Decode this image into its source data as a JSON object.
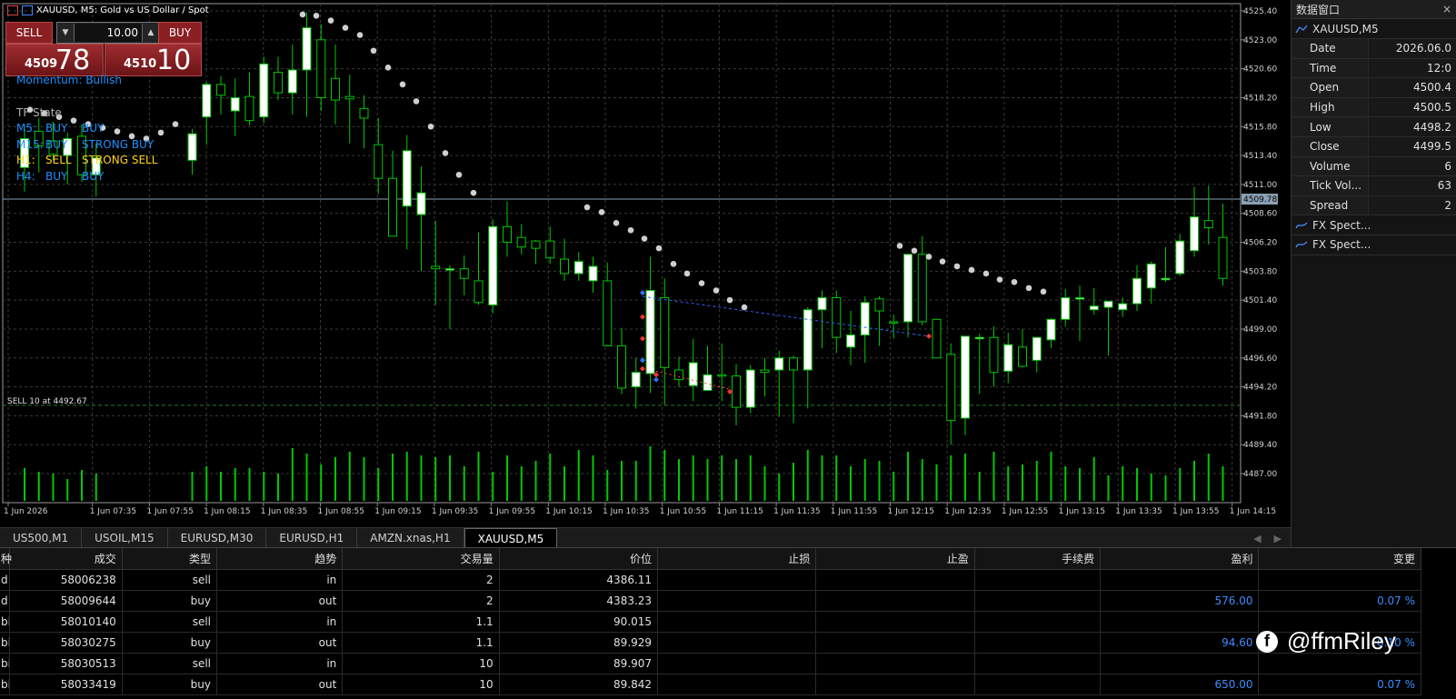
{
  "chart": {
    "header": "XAUUSD, M5:  Gold vs US Dollar / Spot",
    "price_ticks": [
      "4525.40",
      "4523.00",
      "4520.60",
      "4518.20",
      "4515.80",
      "4513.40",
      "4511.00",
      "4508.60",
      "4506.20",
      "4503.80",
      "4501.40",
      "4499.00",
      "4496.60",
      "4494.20",
      "4491.80",
      "4489.40",
      "4487.00"
    ],
    "current_price_label": "4509.78",
    "time_ticks": [
      "1 Jun 2026",
      "1 Jun 07:35",
      "1 Jun 07:55",
      "1 Jun 08:15",
      "1 Jun 08:35",
      "1 Jun 08:55",
      "1 Jun 09:15",
      "1 Jun 09:35",
      "1 Jun 09:55",
      "1 Jun 10:15",
      "1 Jun 10:35",
      "1 Jun 10:55",
      "1 Jun 11:15",
      "1 Jun 11:35",
      "1 Jun 11:55",
      "1 Jun 12:15",
      "1 Jun 12:35",
      "1 Jun 12:55",
      "1 Jun 13:15",
      "1 Jun 13:35",
      "1 Jun 13:55",
      "1 Jun 14:15"
    ],
    "sell_label": "SELL 10 at 4492.67",
    "momentum": "Momentum: Bullish",
    "tf_state_title": "TF State",
    "tf_rows": [
      {
        "tf": "M5:",
        "a": "BUY",
        "b": "BUY",
        "color": "#1e90ff"
      },
      {
        "tf": "M15:",
        "a": "BUY",
        "b": "STRONG BUY",
        "color": "#1e90ff"
      },
      {
        "tf": "H1:",
        "a": "SELL",
        "b": "STRONG SELL",
        "color": "#ffd21f"
      },
      {
        "tf": "H4:",
        "a": "BUY",
        "b": "BUY",
        "color": "#1e90ff"
      }
    ],
    "colors": {
      "bull_body": "#ffffff",
      "bear_body": "#000000",
      "wick": "#00c800",
      "grid": "#3a3a3a",
      "psar": "#cfcfcf"
    }
  },
  "one_click": {
    "sell_label": "SELL",
    "buy_label": "BUY",
    "lot": "10.00",
    "sell_small": "4509",
    "sell_big": "78",
    "buy_small": "4510",
    "buy_big": "10"
  },
  "tabs": [
    "US500,M1",
    "USOIL,M15",
    "EURUSD,M30",
    "EURUSD,H1",
    "AMZN.xnas,H1",
    "XAUUSD,M5"
  ],
  "active_tab": 5,
  "data_window": {
    "title": "数据窗口",
    "close": "×",
    "symbol": "XAUUSD,M5",
    "rows": [
      {
        "k": "Date",
        "v": "2026.06.0"
      },
      {
        "k": "Time",
        "v": "12:0"
      },
      {
        "k": "Open",
        "v": "4500.4"
      },
      {
        "k": "High",
        "v": "4500.5"
      },
      {
        "k": "Low",
        "v": "4498.2"
      },
      {
        "k": "Close",
        "v": "4499.5"
      },
      {
        "k": "Volume",
        "v": "6"
      },
      {
        "k": "Tick Vol...",
        "v": "63"
      },
      {
        "k": "Spread",
        "v": "2"
      }
    ],
    "indicators": [
      "FX Spect...",
      "FX Spect..."
    ]
  },
  "trades": {
    "headers": [
      "种",
      "成交",
      "类型",
      "趋势",
      "交易量",
      "价位",
      "止损",
      "止盈",
      "手续费",
      "盈利",
      "变更"
    ],
    "rows": [
      [
        "d",
        "58006238",
        "sell",
        "in",
        "2",
        "4386.11",
        "",
        "",
        "",
        "",
        ""
      ],
      [
        "d",
        "58009644",
        "buy",
        "out",
        "2",
        "4383.23",
        "",
        "",
        "",
        "576.00",
        "0.07 %"
      ],
      [
        "bil",
        "58010140",
        "sell",
        "in",
        "1.1",
        "90.015",
        "",
        "",
        "",
        "",
        ""
      ],
      [
        "bil",
        "58030275",
        "buy",
        "out",
        "1.1",
        "89.929",
        "",
        "",
        "",
        "94.60",
        "0.10 %"
      ],
      [
        "bil",
        "58030513",
        "sell",
        "in",
        "10",
        "89.907",
        "",
        "",
        "",
        "",
        ""
      ],
      [
        "bil",
        "58033419",
        "buy",
        "out",
        "10",
        "89.842",
        "",
        "",
        "",
        "650.00",
        "0.07 %"
      ]
    ]
  },
  "watermark": "@ffmRiley"
}
